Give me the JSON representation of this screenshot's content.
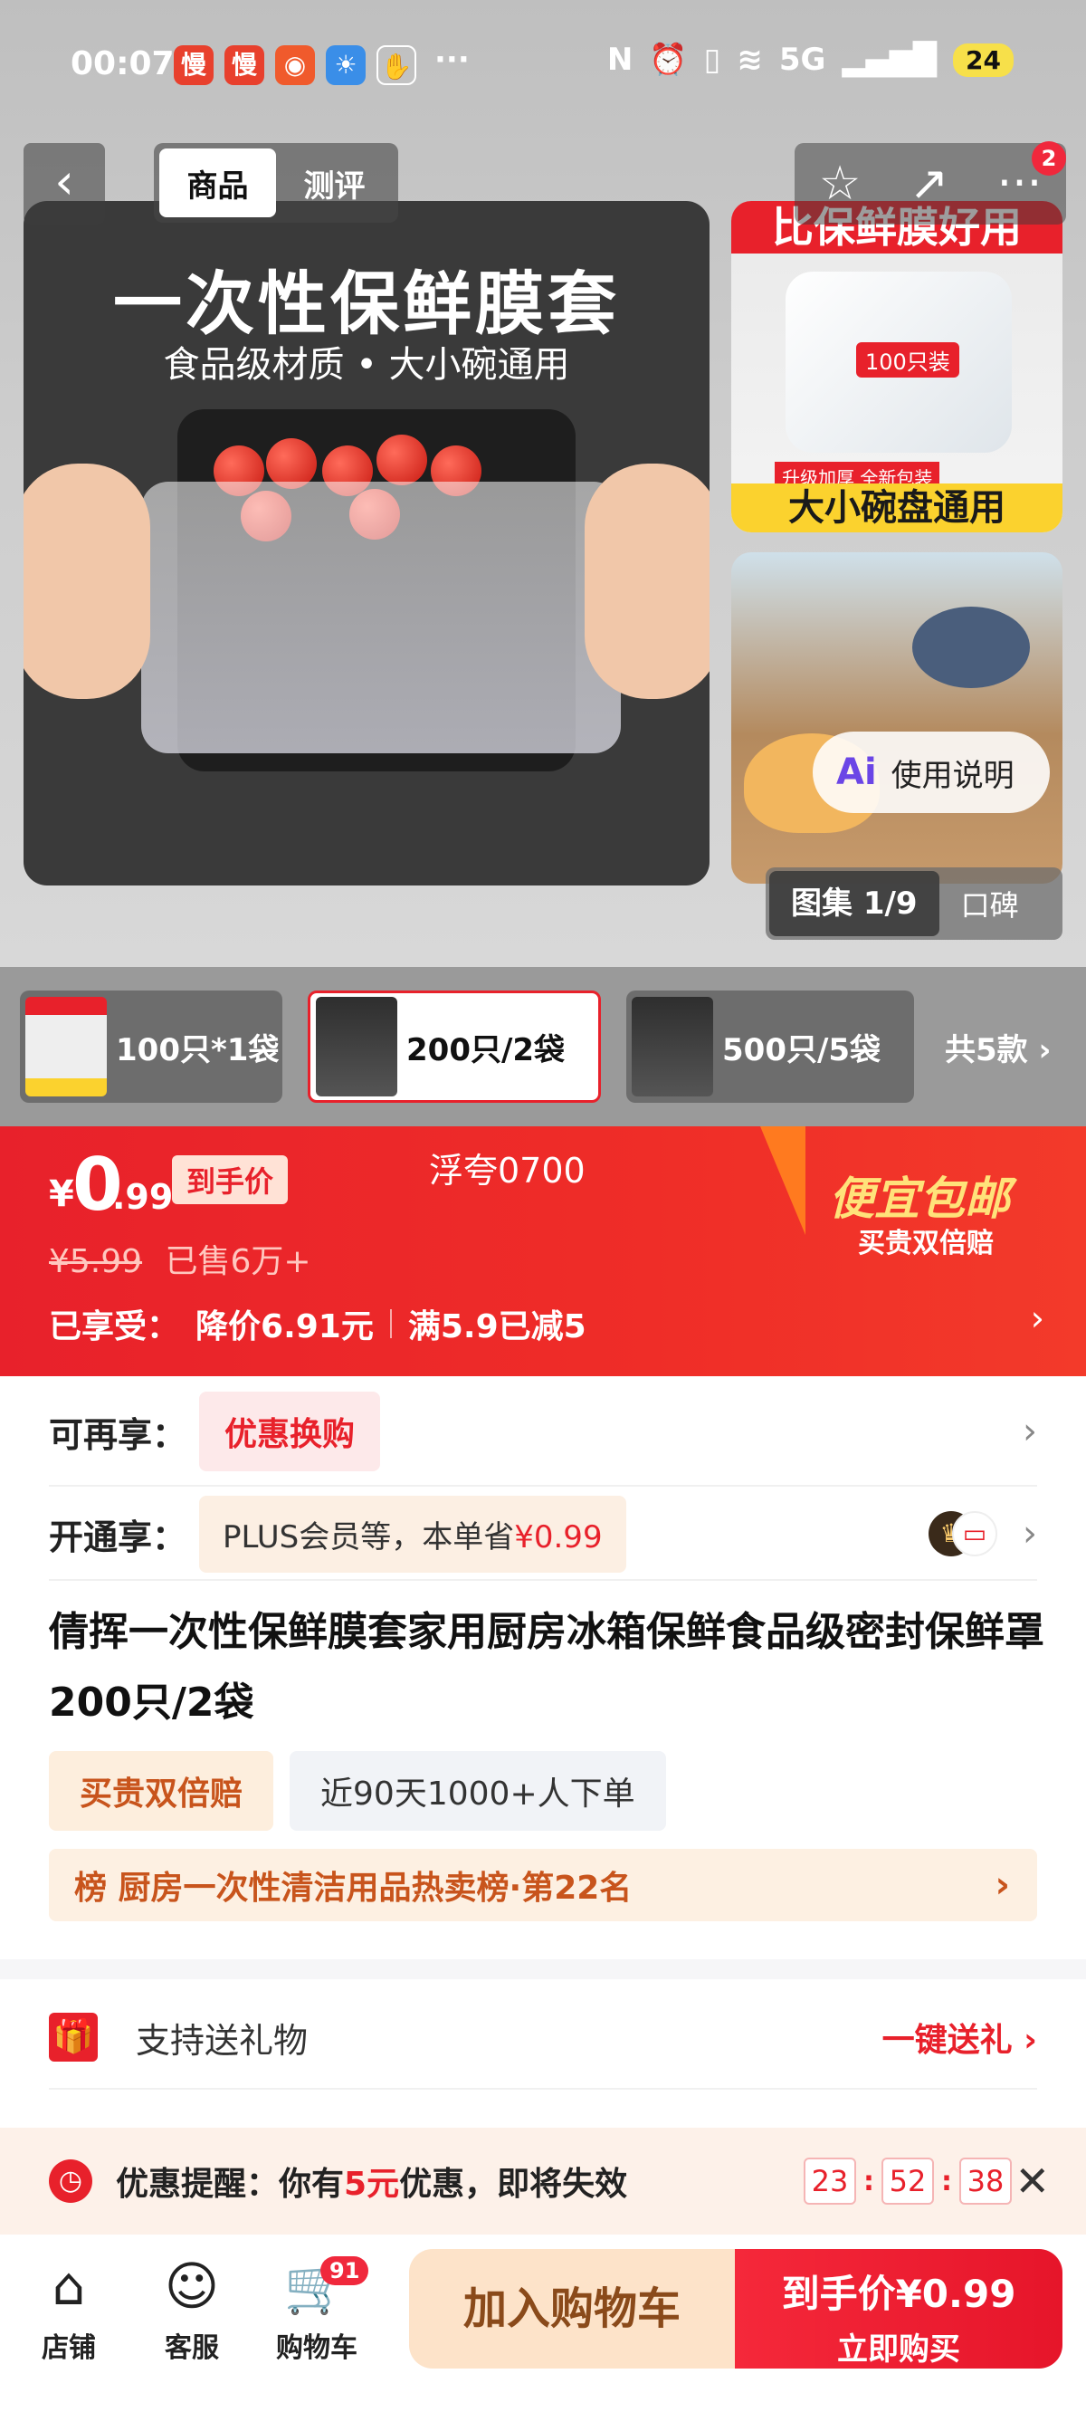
{
  "status_bar": {
    "time": "00:07",
    "network": "5G",
    "battery": "24"
  },
  "header": {
    "tabs": [
      {
        "label": "商品"
      },
      {
        "label": "测评"
      }
    ],
    "notification_count": "2"
  },
  "gallery": {
    "main_title": "一次性保鲜膜套",
    "main_subtitle": "食品级材质 • 大小碗通用",
    "thumb1_banner": "比保鲜膜好用",
    "thumb1_badge": "100只装",
    "thumb1_tag": "升级加厚  全新包装",
    "thumb1_footer": "大小碗盘通用",
    "usage_label": "使用说明",
    "counter": "图集 1/9",
    "review_label": "口碑"
  },
  "variants": {
    "items": [
      {
        "label": "100只*1袋"
      },
      {
        "label": "200只/2袋"
      },
      {
        "label": "500只/5袋"
      }
    ],
    "more_label": "共5款"
  },
  "price": {
    "currency": "¥",
    "integer": "0",
    "decimal": ".99",
    "tag": "到手价",
    "floating_text": "浮夸0700",
    "original": "¥5.99",
    "sold": "已售6万+",
    "shipping_title": "便宜包邮",
    "shipping_sub": "买贵双倍赔",
    "enjoyed_prefix": "已享受：",
    "discount1": "降价6.91元",
    "discount2": "满5.9已减5"
  },
  "offers": {
    "extra_label": "可再享：",
    "extra_pill": "优惠换购",
    "member_label": "开通享：",
    "member_text": "PLUS会员等，本单省",
    "member_amount": "¥0.99"
  },
  "product": {
    "title": "倩挥一次性保鲜膜套家用厨房冰箱保鲜食品级密封保鲜罩 200只/2袋",
    "tag1": "买贵双倍赔",
    "tag2": "近90天1000+人下单",
    "rank": "榜 厨房一次性清洁用品热卖榜·第22名"
  },
  "gift": {
    "label": "支持送礼物",
    "action": "一键送礼"
  },
  "reminder": {
    "prefix": "优惠提醒：你有",
    "amount": "5元",
    "suffix": "优惠，即将失效",
    "hours": "23",
    "minutes": "52",
    "seconds": "38"
  },
  "bottom_nav": {
    "store": "店铺",
    "service": "客服",
    "cart": "购物车",
    "cart_count": "91",
    "add_to_cart": "加入购物车",
    "buy_price": "到手价¥0.99",
    "buy_now": "立即购买"
  },
  "colors": {
    "brand_red": "#e8212b",
    "accent_gold": "#c8541c"
  }
}
